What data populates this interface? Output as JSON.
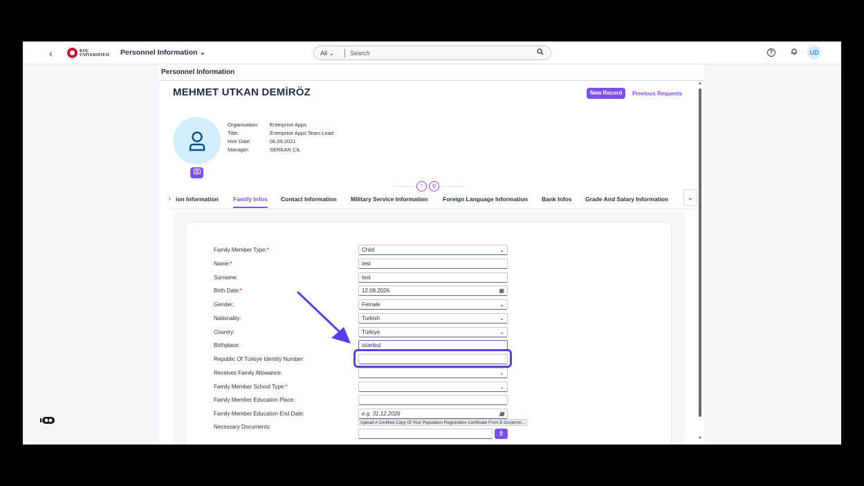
{
  "shell": {
    "back_label": "‹",
    "logo_lines": [
      "KOÇ",
      "ÜNİVERSİTESİ"
    ],
    "app_title": "Personnel Information ⌄",
    "search_scope": "All  ⌄",
    "search_placeholder": "Search",
    "user_initials": "UD"
  },
  "page": {
    "title": "Personnel Information",
    "employee_name": "MEHMET UTKAN DEMİRÖZ",
    "new_record_label": "New Record",
    "previous_requests_label": "Previous Requests",
    "info": [
      {
        "key": "Organisation:",
        "value": "Enterprise Apps"
      },
      {
        "key": "Title:",
        "value": "Enterprise Apps Team Lead"
      },
      {
        "key": "Hire Date:",
        "value": "06.09.2021"
      },
      {
        "key": "Manager:",
        "value": "SERKAN ÇİL"
      }
    ]
  },
  "tabs": [
    {
      "label": "ion Information",
      "active": false
    },
    {
      "label": "Family Infos",
      "active": true
    },
    {
      "label": "Contact Information",
      "active": false
    },
    {
      "label": "Military Service Information",
      "active": false
    },
    {
      "label": "Foreign Language Information",
      "active": false
    },
    {
      "label": "Bank Infos",
      "active": false
    },
    {
      "label": "Grade And Salary Information",
      "active": false
    }
  ],
  "form": {
    "rows": [
      {
        "label": "Family Member Type:",
        "required": true,
        "value": "Child",
        "kind": "select"
      },
      {
        "label": "Name:",
        "required": true,
        "value": "test",
        "kind": "input"
      },
      {
        "label": "Surname:",
        "required": false,
        "value": "test",
        "kind": "input"
      },
      {
        "label": "Birth Date:",
        "required": true,
        "value": "12.08.2026",
        "kind": "date"
      },
      {
        "label": "Gender:",
        "required": false,
        "value": "Female",
        "kind": "select"
      },
      {
        "label": "Nationality:",
        "required": false,
        "value": "Turkish",
        "kind": "select"
      },
      {
        "label": "Country:",
        "required": false,
        "value": "Türkiye",
        "kind": "select"
      },
      {
        "label": "Birthplace:",
        "required": false,
        "value": "istanbul",
        "kind": "input"
      },
      {
        "label": "Republic Of Türkiye Identity Number:",
        "required": false,
        "value": "",
        "kind": "input"
      },
      {
        "label": "Receives Family Allowance:",
        "required": false,
        "value": "",
        "kind": "select"
      },
      {
        "label": "Family Member School Type:",
        "required": true,
        "value": "",
        "kind": "select"
      },
      {
        "label": "Family Member Education Place:",
        "required": false,
        "value": "",
        "kind": "input"
      },
      {
        "label": "Family Member Education End Date:",
        "required": false,
        "value": "",
        "placeholder": "e.g. 31.12.2026",
        "kind": "date"
      }
    ],
    "documents_label": "Necessary Documents:",
    "upload_hint": "Upload A Certified Copy Of Your Population Registration Certificate From E-Governm..."
  },
  "colors": {
    "accent": "#7b4ff0",
    "annotation": "#5b3df0"
  }
}
